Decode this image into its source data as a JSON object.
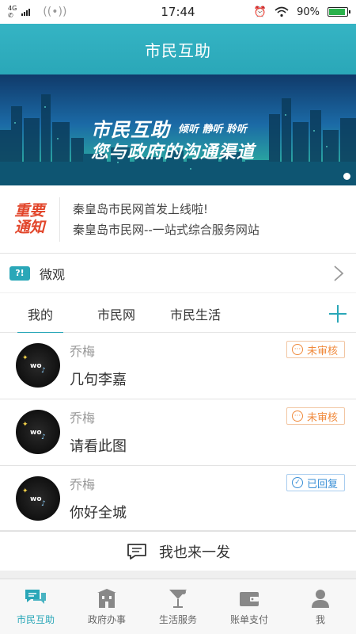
{
  "status_bar": {
    "network_type": "4G",
    "time": "17:44",
    "battery_percent": "90%",
    "battery_level": 0.9
  },
  "header": {
    "title": "市民互助"
  },
  "banner": {
    "title": "市民互助",
    "tags": "倾听 静听 聆听",
    "subtitle": "您与政府的沟通渠道"
  },
  "notice": {
    "badge_line1": "重要",
    "badge_line2": "通知",
    "line1": "秦皇岛市民网首发上线啦!",
    "line2": "秦皇岛市民网--一站式综合服务网站"
  },
  "weiguan": {
    "icon_text": "?!",
    "label": "微观"
  },
  "tabs": [
    {
      "label": "我的",
      "active": true
    },
    {
      "label": "市民网",
      "active": false
    },
    {
      "label": "市民生活",
      "active": false
    }
  ],
  "posts": [
    {
      "author": "乔梅",
      "text": "几句李嘉",
      "status": "未审核",
      "status_type": "pending"
    },
    {
      "author": "乔梅",
      "text": "请看此图",
      "status": "未审核",
      "status_type": "pending"
    },
    {
      "author": "乔梅",
      "text": "你好全城",
      "status": "已回复",
      "status_type": "replied"
    }
  ],
  "cta": {
    "label": "我也来一发"
  },
  "bottom_nav": [
    {
      "label": "市民互助",
      "icon": "chat-icon",
      "active": true
    },
    {
      "label": "政府办事",
      "icon": "building-icon",
      "active": false
    },
    {
      "label": "生活服务",
      "icon": "cocktail-icon",
      "active": false
    },
    {
      "label": "账单支付",
      "icon": "wallet-icon",
      "active": false
    },
    {
      "label": "我",
      "icon": "person-icon",
      "active": false
    }
  ],
  "colors": {
    "accent": "#2aa7b8",
    "notice_red": "#e2462b",
    "pending_orange": "#f08a3c",
    "replied_blue": "#3a8fd6"
  }
}
